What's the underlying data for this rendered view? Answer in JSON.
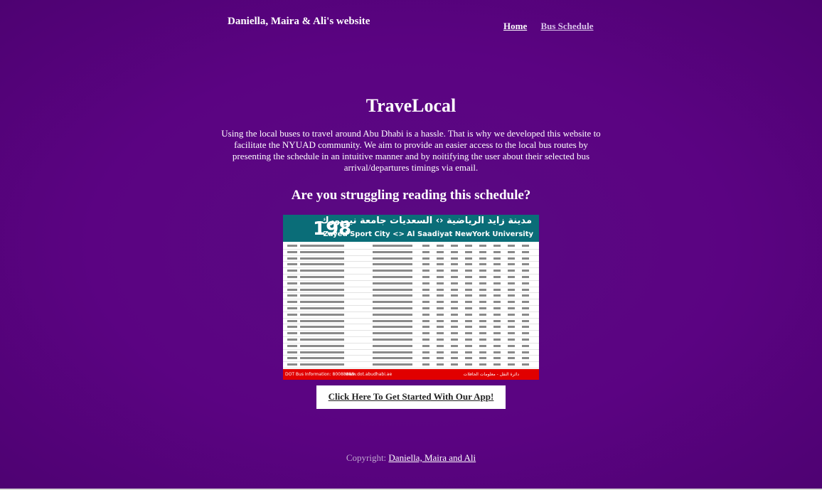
{
  "header": {
    "site_title": "Daniella, Maira & Ali's website",
    "nav": [
      {
        "label": "Home"
      },
      {
        "label": "Bus Schedule"
      }
    ]
  },
  "main": {
    "title": "TraveLocal",
    "intro": "Using the local buses to travel around Abu Dhabi is a hassle. That is why we developed this website to facilitate the NYUAD community. We aim to provide an easier access to the local bus routes by presenting the schedule in an intuitive manner and by noitifying the user about their selected bus arrival/departures timings via email.",
    "question": "Are you struggling reading this schedule?",
    "schedule_image": {
      "route_number": "198",
      "arabic_title": "مدينة زايد الرياضية ‹› السعديات جامعة نيويورك",
      "english_title": "Zayed Sport City <> Al Saadiyat NewYork University",
      "footer_left": "DOT Bus Information: 80088888",
      "footer_url": "www.dot.abudhabi.ae",
      "footer_arabic": "دائرة النقل - معلومات الحافلات"
    },
    "cta_label": "Click Here To Get Started With Our App!"
  },
  "footer": {
    "label": "Copyright:",
    "authors": "Daniella, Maira and Ali"
  },
  "colors": {
    "background": "#5b0382",
    "schedule_header": "#0a6d78",
    "schedule_footer": "#e10000"
  }
}
